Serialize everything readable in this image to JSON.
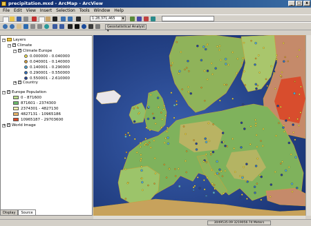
{
  "window": {
    "title": "precipitation.mxd - ArcMap - ArcView",
    "min": "_",
    "max": "□",
    "close": "x"
  },
  "menu": [
    "File",
    "Edit",
    "View",
    "Insert",
    "Selection",
    "Tools",
    "Window",
    "Help"
  ],
  "toolbar": {
    "scale_value": "1:28,371,465",
    "search_value": "",
    "geostat_label": "Geostatistical Analyst ▾"
  },
  "toc": {
    "layers_label": "Layers",
    "climate_label": "Climate",
    "climate_europe_label": "Climate Europe",
    "legend_dots": [
      {
        "label": "0.000000 - 0.040000",
        "color": "#f2e24a"
      },
      {
        "label": "0.040001 - 0.140000",
        "color": "#d9a23a"
      },
      {
        "label": "0.140001 - 0.290000",
        "color": "#4aa7d8"
      },
      {
        "label": "0.290001 - 0.550000",
        "color": "#2c6fc0"
      },
      {
        "label": "0.550001 - 2.610000",
        "color": "#1f3f9a"
      }
    ],
    "country_label": "Country",
    "europe_pop_label": "Europe Population",
    "pop_classes": [
      {
        "label": "0 - 871600",
        "color": "#b9dc8e"
      },
      {
        "label": "871601 - 2374300",
        "color": "#6bbd6b"
      },
      {
        "label": "2374301 - 4827130",
        "color": "#f3f0b0"
      },
      {
        "label": "4827131 - 10965186",
        "color": "#e9b56a"
      },
      {
        "label": "10965187 - 29703600",
        "color": "#d94a2a"
      }
    ],
    "world_image_label": "World Image"
  },
  "tabs": {
    "display": "Display",
    "source": "Source"
  },
  "status": {
    "coords": "3049535.09 3219056.74 Meters"
  }
}
